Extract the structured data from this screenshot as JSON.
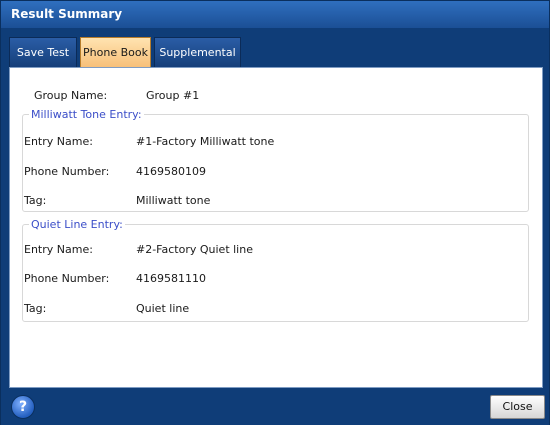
{
  "window": {
    "title": "Result Summary"
  },
  "tabs": [
    {
      "label": "Save Test",
      "active": false
    },
    {
      "label": "Phone Book",
      "active": true
    },
    {
      "label": "Supplemental",
      "active": false
    }
  ],
  "phone_book": {
    "group_label": "Group Name:",
    "group_value": "Group #1",
    "milliwatt": {
      "legend": "Milliwatt Tone Entry:",
      "entry_label": "Entry Name:",
      "entry_value": "#1-Factory Milliwatt tone",
      "phone_label": "Phone Number:",
      "phone_value": "4169580109",
      "tag_label": "Tag:",
      "tag_value": "Milliwatt tone"
    },
    "quiet": {
      "legend": "Quiet Line Entry:",
      "entry_label": "Entry Name:",
      "entry_value": "#2-Factory Quiet line",
      "phone_label": "Phone Number:",
      "phone_value": "4169581110",
      "tag_label": "Tag:",
      "tag_value": "Quiet line"
    }
  },
  "bottom": {
    "help_icon": "question-circle-icon",
    "help_glyph": "?",
    "close_label": "Close"
  },
  "colors": {
    "frame": "#0f3d78",
    "active_tab": "#f7c07a",
    "legend": "#3b4ec8"
  }
}
